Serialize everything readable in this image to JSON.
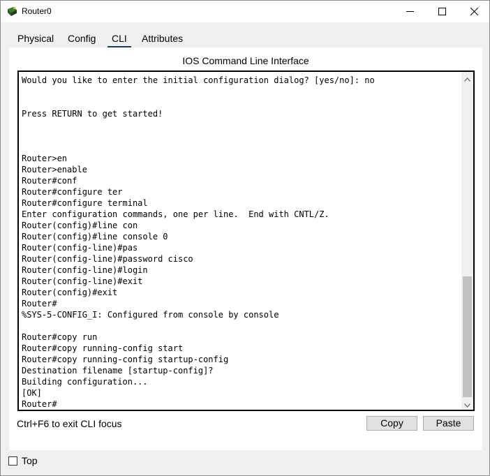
{
  "window": {
    "title": "Router0",
    "controls": {
      "minimize": "minimize",
      "maximize": "maximize",
      "close": "close"
    }
  },
  "tabs": [
    {
      "label": "Physical",
      "active": false
    },
    {
      "label": "Config",
      "active": false
    },
    {
      "label": "CLI",
      "active": true
    },
    {
      "label": "Attributes",
      "active": false
    }
  ],
  "panel": {
    "title": "IOS Command Line Interface",
    "terminal_lines": [
      "Would you like to enter the initial configuration dialog? [yes/no]: no",
      "",
      "",
      "Press RETURN to get started!",
      "",
      "",
      "",
      "Router>en",
      "Router>enable",
      "Router#conf",
      "Router#configure ter",
      "Router#configure terminal",
      "Enter configuration commands, one per line.  End with CNTL/Z.",
      "Router(config)#line con",
      "Router(config)#line console 0",
      "Router(config-line)#pas",
      "Router(config-line)#password cisco",
      "Router(config-line)#login",
      "Router(config-line)#exit",
      "Router(config)#exit",
      "Router#",
      "%SYS-5-CONFIG_I: Configured from console by console",
      "",
      "Router#copy run",
      "Router#copy running-config start",
      "Router#copy running-config startup-config",
      "Destination filename [startup-config]?",
      "Building configuration...",
      "[OK]",
      "Router#"
    ],
    "focus_hint": "Ctrl+F6 to exit CLI focus",
    "copy_label": "Copy",
    "paste_label": "Paste"
  },
  "footer": {
    "top_label": "Top",
    "top_checked": false
  },
  "colors": {
    "active_tab_underline": "#1f3a5f",
    "button_bg": "#e1e1e1",
    "scroll_thumb": "#c1c1c1"
  }
}
